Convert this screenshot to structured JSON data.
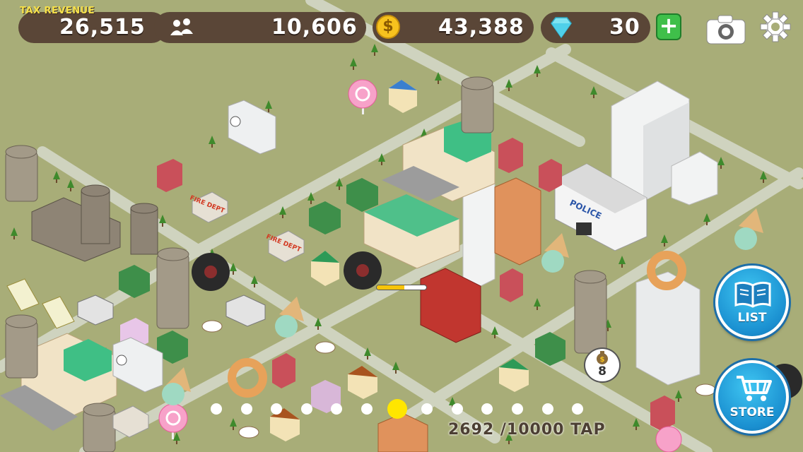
{
  "hud": {
    "tax_label": "TAX REVENUE",
    "tax_value": "26,515",
    "population": "10,606",
    "coins": "43,388",
    "gems": "30",
    "plus_symbol": "+",
    "coin_symbol": "$"
  },
  "buttons": {
    "list_label": "LIST",
    "store_label": "STORE"
  },
  "map_signs": {
    "police": "POLICE",
    "fire": "FIRE DEPT"
  },
  "progress": {
    "tap_text": "2692 /10000 TAP",
    "current": 2692,
    "total": 10000,
    "page_count": 13,
    "active_page": 7
  },
  "bubble": {
    "coin_count": "8"
  },
  "colors": {
    "ground": "#a8ad78",
    "road": "#cfd3bf",
    "hud_pill": "#5a4637",
    "accent_blue": "#1a8fd0",
    "plus_green": "#3fbf4a",
    "active_dot": "#ffe600"
  },
  "icons": [
    "people-icon",
    "coin-icon",
    "gem-icon",
    "plus-icon",
    "camera-icon",
    "gear-icon",
    "book-icon",
    "cart-icon"
  ]
}
